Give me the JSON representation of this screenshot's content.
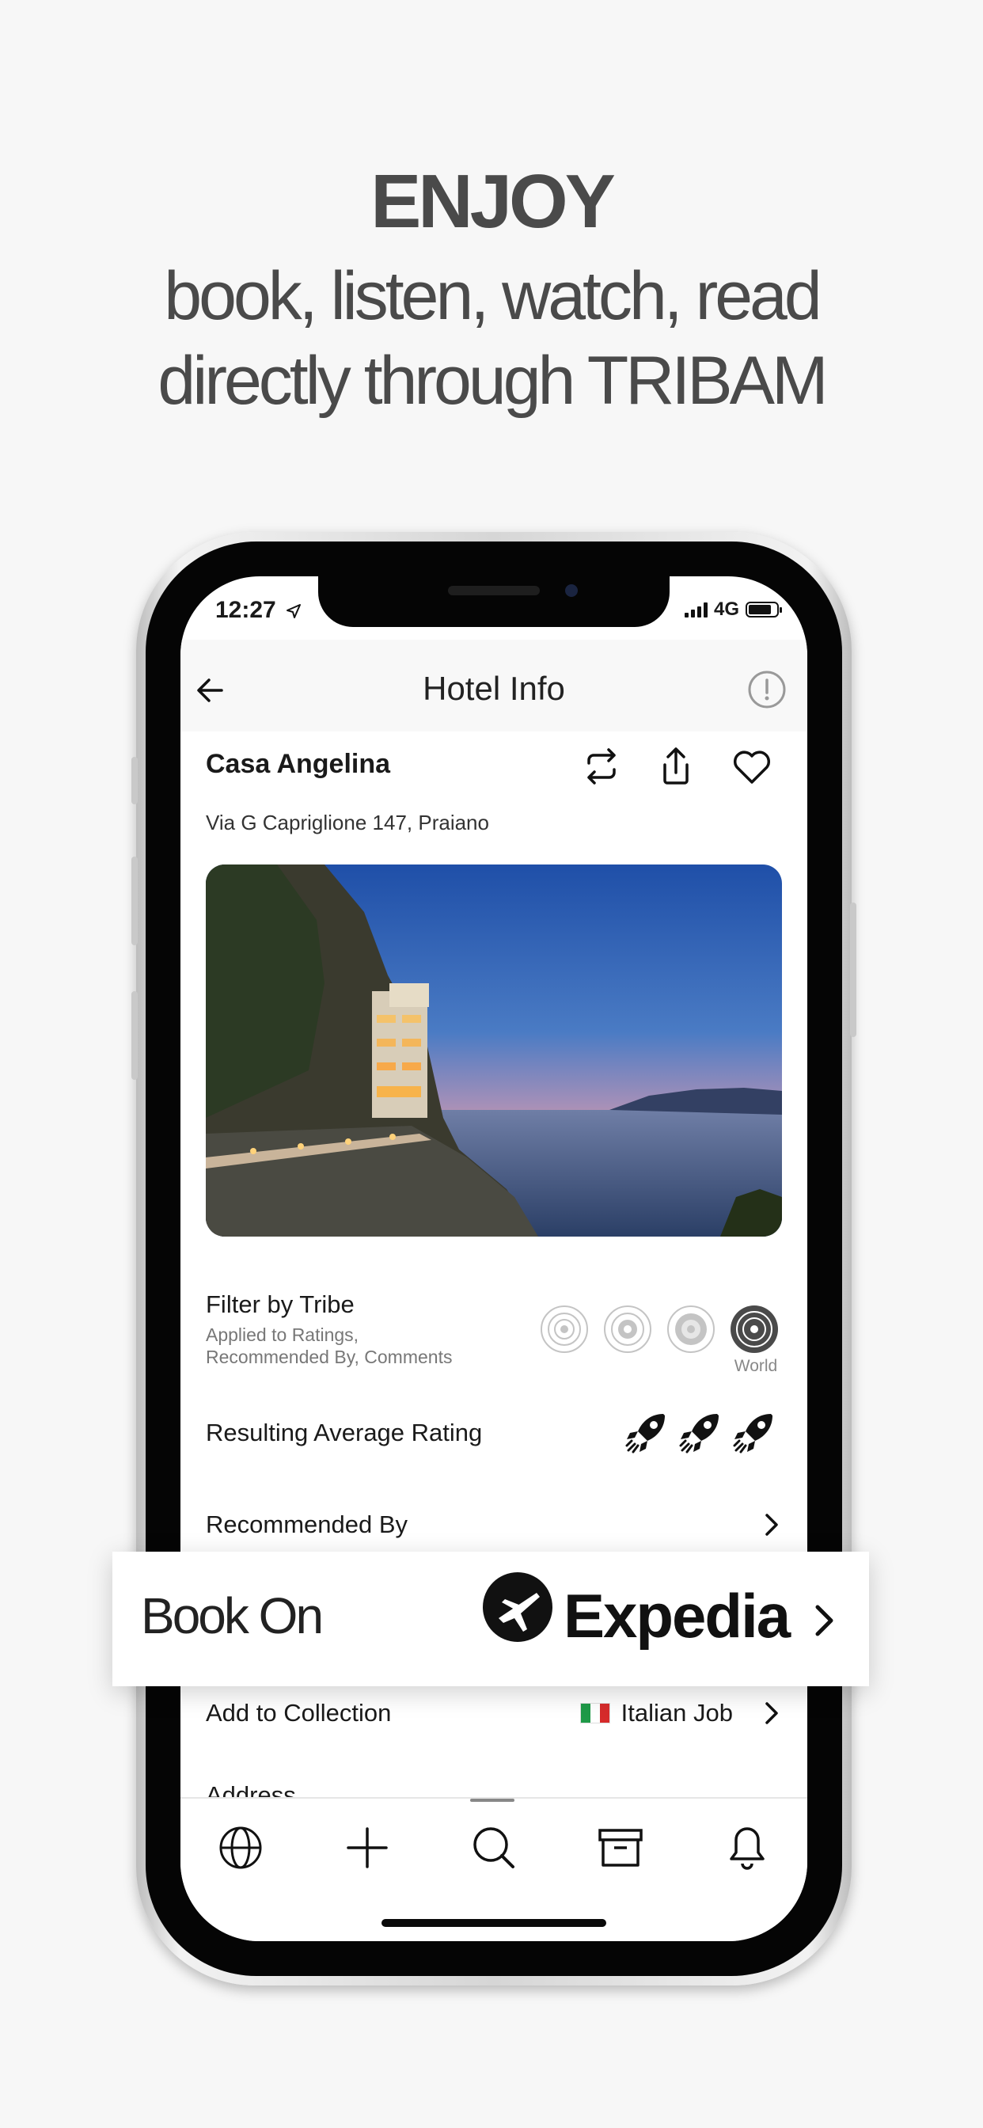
{
  "promo": {
    "headline": "ENJOY",
    "line1": "book, listen, watch, read",
    "line2": "directly through TRIBAM"
  },
  "status_bar": {
    "time": "12:27",
    "network": "4G"
  },
  "nav": {
    "title": "Hotel Info"
  },
  "hotel": {
    "name": "Casa Angelina",
    "address": "Via G Capriglione 147, Praiano"
  },
  "filter": {
    "title": "Filter by Tribe",
    "description_line1": "Applied to Ratings,",
    "description_line2": "Recommended By, Comments",
    "selected_label": "World"
  },
  "rating": {
    "label": "Resulting Average Rating",
    "value": 3,
    "max": 3
  },
  "recommended": {
    "label": "Recommended By"
  },
  "booking": {
    "label": "Book On",
    "provider": "Expedia"
  },
  "collection": {
    "label": "Add to Collection",
    "value": "Italian Job"
  },
  "address_section": {
    "label": "Address"
  },
  "tabs": [
    "globe-icon",
    "plus-icon",
    "search-icon",
    "archive-icon",
    "bell-icon"
  ],
  "colors": {
    "background": "#f7f7f7",
    "headline": "#4a4a4a",
    "text": "#1a1a1a",
    "muted": "#777777"
  }
}
